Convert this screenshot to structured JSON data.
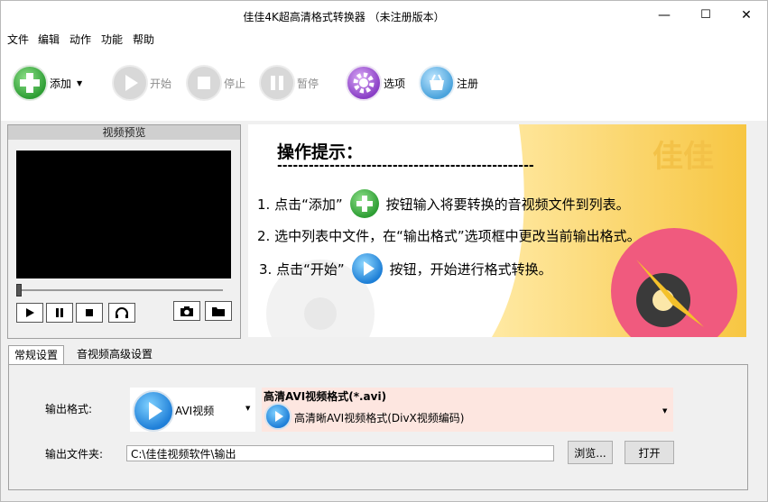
{
  "window": {
    "title": "佳佳4K超高清格式转换器 （未注册版本）",
    "minimize": "—",
    "maximize": "☐",
    "close": "✕"
  },
  "menu": [
    "文件",
    "编辑",
    "动作",
    "功能",
    "帮助"
  ],
  "toolbar": {
    "add": "添加",
    "start": "开始",
    "stop": "停止",
    "pause": "暂停",
    "options": "选项",
    "register": "注册"
  },
  "preview": {
    "title": "视频预览"
  },
  "banner": {
    "heading": "操作提示：",
    "dashes": "-------------------------------------------------",
    "step1_a": "1. 点击“添加”",
    "step1_b": "按钮输入将要转换的音视频文件到列表。",
    "step2": "2. 选中列表中文件，在“输出格式”选项框中更改当前输出格式。",
    "step3_a": "3. 点击“开始”",
    "step3_b": "按钮，开始进行格式转换。",
    "brand": "佳佳"
  },
  "tabs": [
    "常规设置",
    "音视频高级设置"
  ],
  "settings": {
    "output_format_label": "输出格式:",
    "format_category": "AVI视频",
    "format_title": "高清AVI视频格式(*.avi)",
    "format_selected": "高清晰AVI视频格式(DivX视频编码)",
    "output_folder_label": "输出文件夹:",
    "output_folder_value": "C:\\佳佳视频软件\\输出",
    "browse_button": "浏览...",
    "open_button": "打开"
  }
}
